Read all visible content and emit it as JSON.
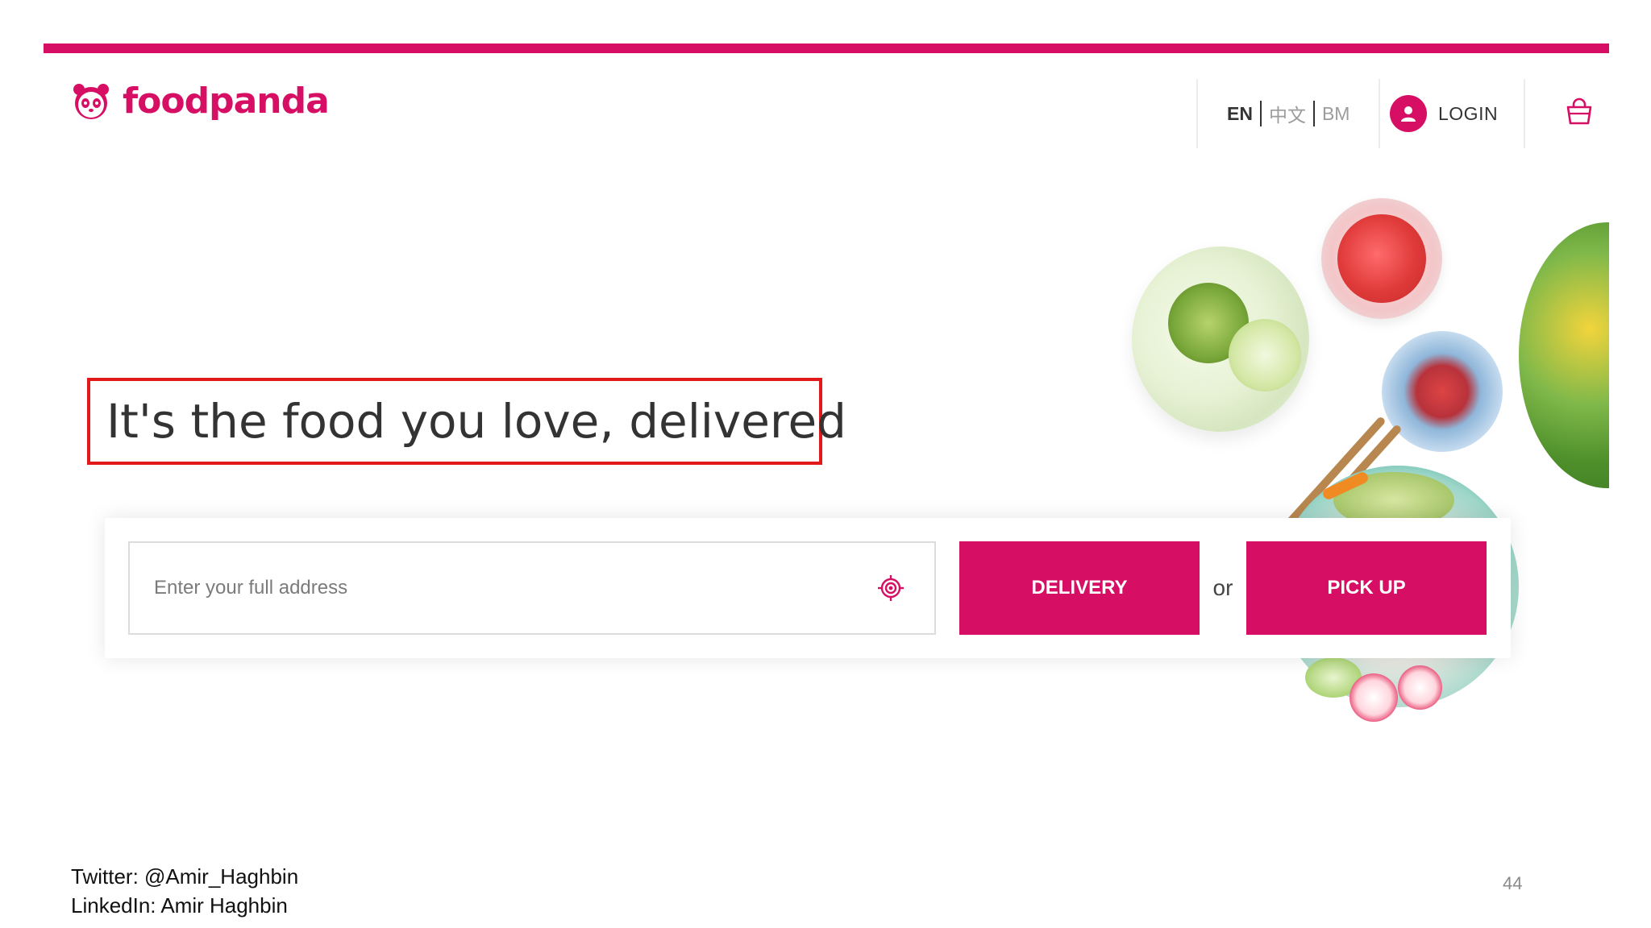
{
  "header": {
    "brand": "foodpanda",
    "languages": [
      {
        "label": "EN",
        "active": true
      },
      {
        "label": "中文",
        "active": false
      },
      {
        "label": "BM",
        "active": false
      }
    ],
    "login_label": "LOGIN"
  },
  "hero": {
    "title": "It's the food you love, delivered"
  },
  "search": {
    "address_placeholder": "Enter your full address",
    "delivery_label": "DELIVERY",
    "or_label": "or",
    "pickup_label": "PICK UP"
  },
  "slide": {
    "twitter": "Twitter: @Amir_Haghbin",
    "linkedin": "LinkedIn: Amir Haghbin",
    "page_number": "44"
  },
  "colors": {
    "brand": "#d70f64",
    "highlight_box": "#e2191b"
  },
  "icons": [
    "panda-logo-icon",
    "user-icon",
    "shopping-bag-icon",
    "locate-icon"
  ]
}
